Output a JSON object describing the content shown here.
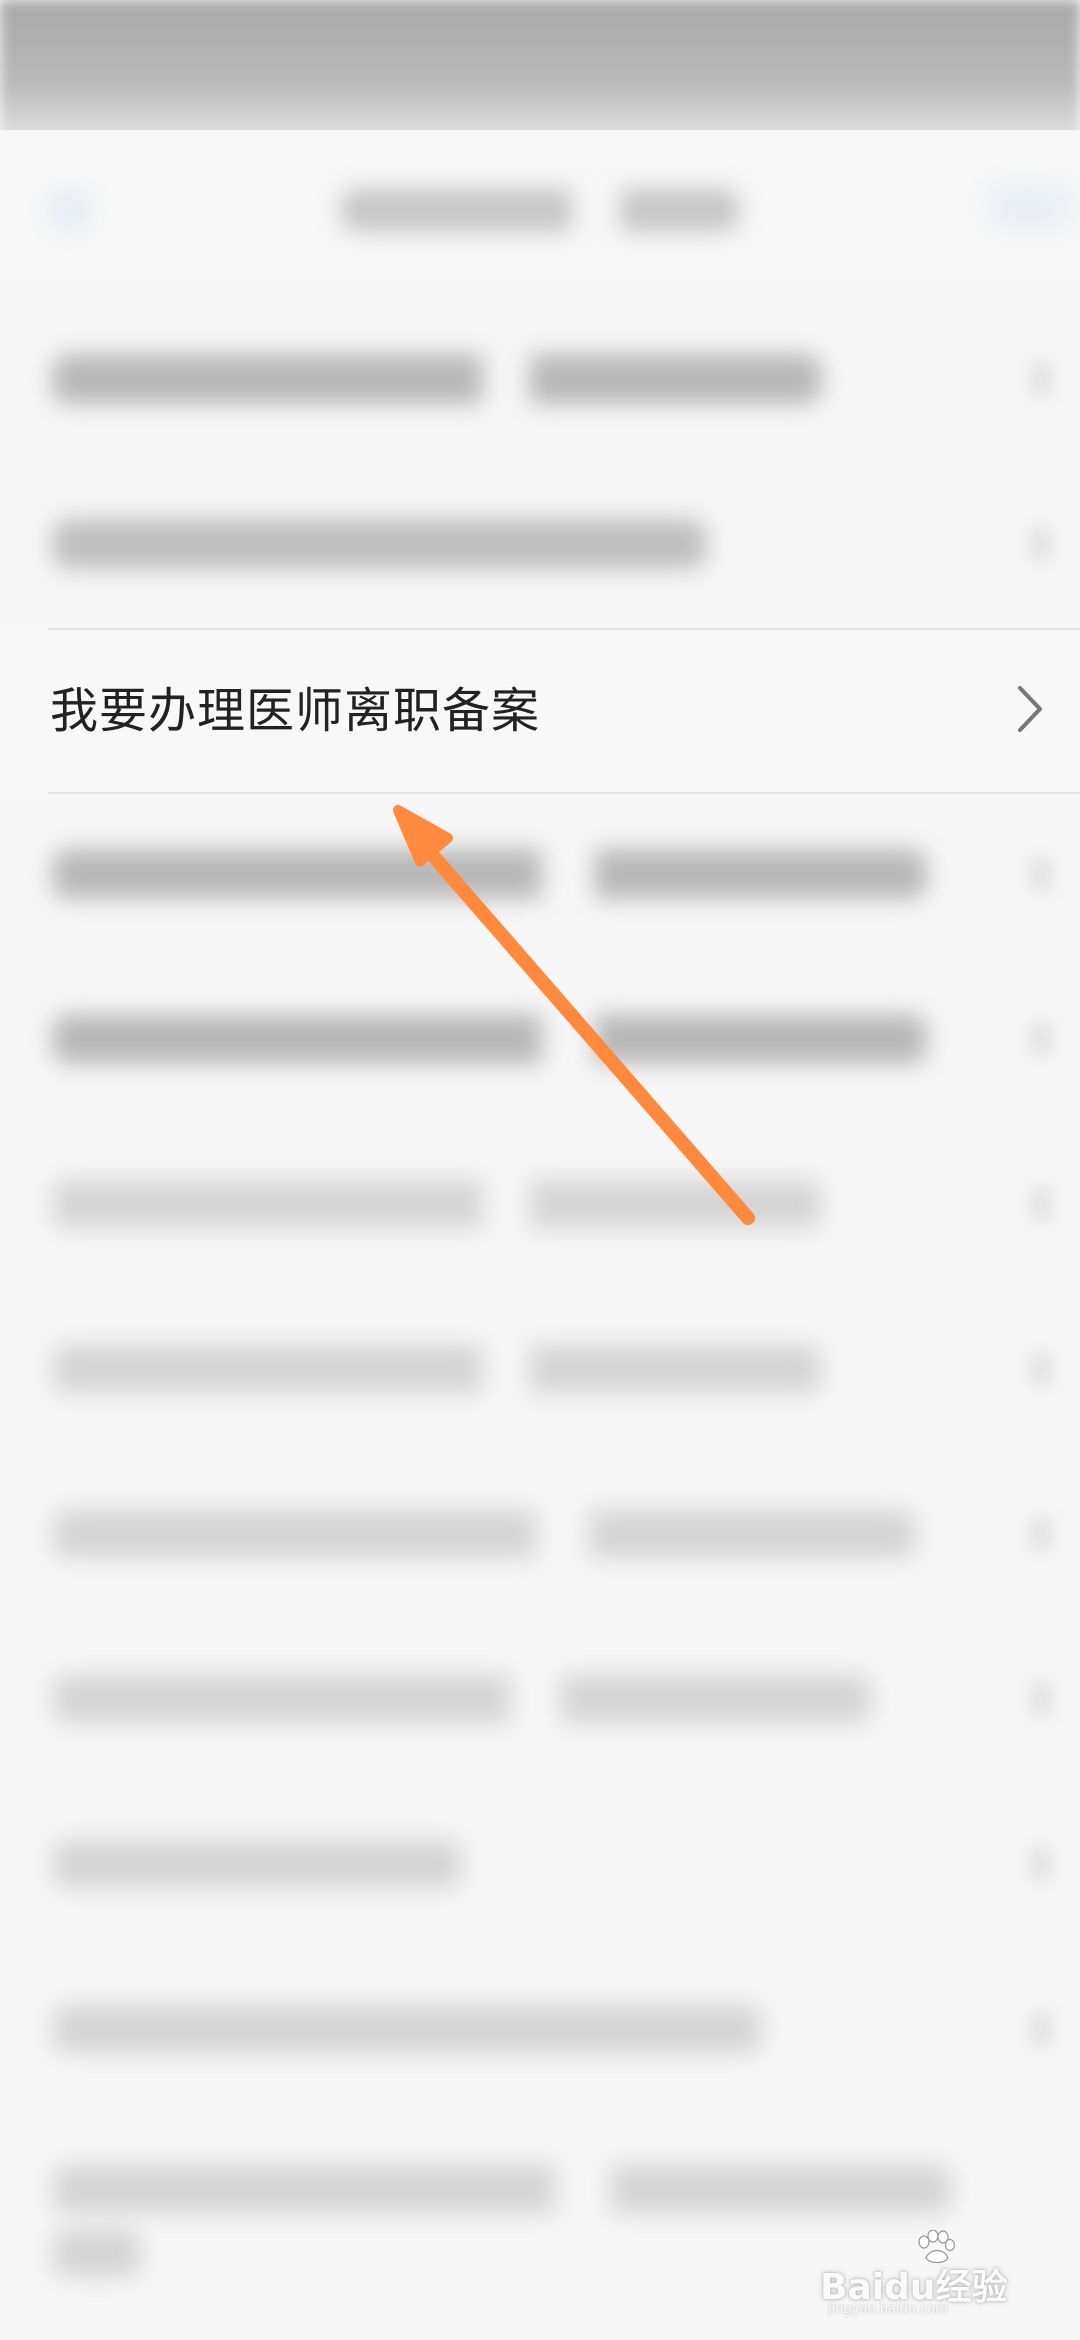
{
  "list": {
    "highlighted_item": {
      "label": "我要办理医师离职备案"
    }
  },
  "annotation": {
    "arrow_color": "#ff8a3d"
  },
  "watermark": {
    "brand": "Baidu经验",
    "url": "jingyan.baidu.com"
  },
  "colors": {
    "background": "#f7f7f7",
    "text_primary": "#222222",
    "divider": "#e3e3e3",
    "chevron": "#777777"
  }
}
